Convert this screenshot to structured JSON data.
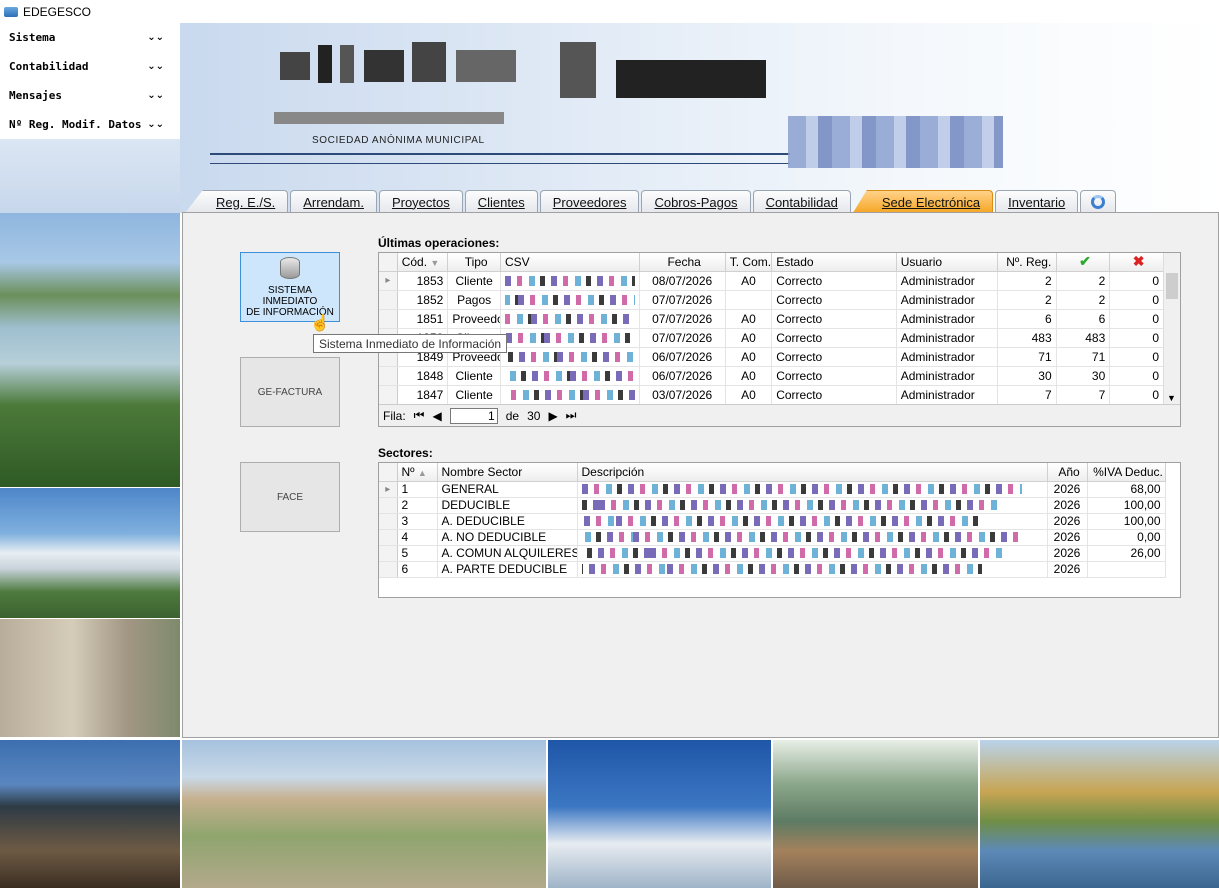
{
  "window": {
    "title": "EDEGESCO"
  },
  "menu": {
    "items": [
      {
        "label": "Sistema"
      },
      {
        "label": "Contabilidad"
      },
      {
        "label": "Mensajes"
      },
      {
        "label": "Nº Reg. Modif. Datos"
      }
    ]
  },
  "header": {
    "subtitle": "SOCIEDAD ANÓNIMA MUNICIPAL"
  },
  "tabs": [
    {
      "label": "Reg. E./S."
    },
    {
      "label": "Arrendam."
    },
    {
      "label": "Proyectos"
    },
    {
      "label": "Clientes"
    },
    {
      "label": "Proveedores"
    },
    {
      "label": "Cobros-Pagos"
    },
    {
      "label": "Contabilidad"
    },
    {
      "label": "Sede Electrónica",
      "active": true
    },
    {
      "label": "Inventario"
    },
    {
      "icon": "refresh-icon"
    }
  ],
  "buttons": {
    "sii_line1": "SISTEMA INMEDIATO",
    "sii_line2": "DE INFORMACIÓN",
    "gefactura": "GE-FACTURA",
    "face": "FACE",
    "tooltip": "Sistema Inmediato de Información"
  },
  "operations": {
    "title": "Últimas operaciones:",
    "columns": [
      "Cód.",
      "Tipo",
      "CSV",
      "Fecha",
      "T. Com.",
      "Estado",
      "Usuario",
      "Nº. Reg.",
      "check-icon",
      "cross-icon"
    ],
    "rows": [
      {
        "cod": "1853",
        "tipo": "Cliente",
        "fecha": "08/07/2026",
        "tcom": "A0",
        "estado": "Correcto",
        "usuario": "Administrador",
        "nreg": "2",
        "ok": "2",
        "ko": "0"
      },
      {
        "cod": "1852",
        "tipo": "Pagos",
        "fecha": "07/07/2026",
        "tcom": "",
        "estado": "Correcto",
        "usuario": "Administrador",
        "nreg": "2",
        "ok": "2",
        "ko": "0"
      },
      {
        "cod": "1851",
        "tipo": "Proveedo",
        "fecha": "07/07/2026",
        "tcom": "A0",
        "estado": "Correcto",
        "usuario": "Administrador",
        "nreg": "6",
        "ok": "6",
        "ko": "0"
      },
      {
        "cod": "1850",
        "tipo": "Cliente",
        "fecha": "07/07/2026",
        "tcom": "A0",
        "estado": "Correcto",
        "usuario": "Administrador",
        "nreg": "483",
        "ok": "483",
        "ko": "0"
      },
      {
        "cod": "1849",
        "tipo": "Proveedo",
        "fecha": "06/07/2026",
        "tcom": "A0",
        "estado": "Correcto",
        "usuario": "Administrador",
        "nreg": "71",
        "ok": "71",
        "ko": "0"
      },
      {
        "cod": "1848",
        "tipo": "Cliente",
        "fecha": "06/07/2026",
        "tcom": "A0",
        "estado": "Correcto",
        "usuario": "Administrador",
        "nreg": "30",
        "ok": "30",
        "ko": "0"
      },
      {
        "cod": "1847",
        "tipo": "Cliente",
        "fecha": "03/07/2026",
        "tcom": "A0",
        "estado": "Correcto",
        "usuario": "Administrador",
        "nreg": "7",
        "ok": "7",
        "ko": "0"
      }
    ],
    "pager": {
      "label": "Fila:",
      "current": "1",
      "of": "de",
      "total": "30"
    }
  },
  "sectors": {
    "title": "Sectores:",
    "columns": [
      "Nº",
      "Nombre Sector",
      "Descripción",
      "Año",
      "%IVA Deduc."
    ],
    "rows": [
      {
        "n": "1",
        "nombre": "GENERAL",
        "anio": "2026",
        "iva": "68,00"
      },
      {
        "n": "2",
        "nombre": "DEDUCIBLE",
        "anio": "2026",
        "iva": "100,00"
      },
      {
        "n": "3",
        "nombre": "A. DEDUCIBLE",
        "anio": "2026",
        "iva": "100,00"
      },
      {
        "n": "4",
        "nombre": "A. NO DEDUCIBLE",
        "anio": "2026",
        "iva": "0,00"
      },
      {
        "n": "5",
        "nombre": "A. COMUN ALQUILERES",
        "anio": "2026",
        "iva": "26,00"
      },
      {
        "n": "6",
        "nombre": "A. PARTE DEDUCIBLE",
        "anio": "2026",
        "iva": ""
      }
    ]
  },
  "colors": {
    "accent_tab": "#f5a623",
    "check": "#2fa82f",
    "cross": "#d22"
  }
}
